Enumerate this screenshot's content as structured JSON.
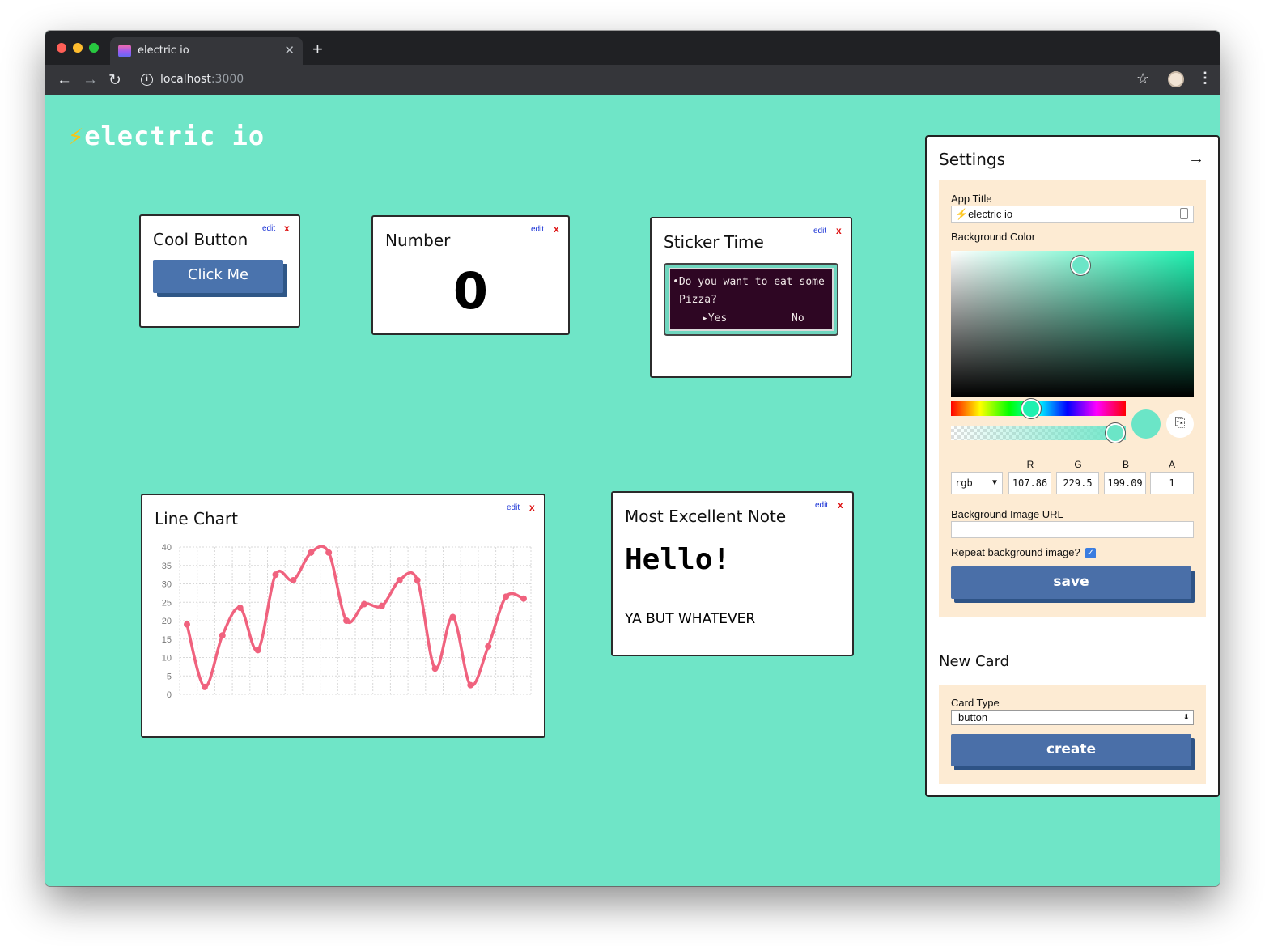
{
  "browser": {
    "tab_title": "electric io",
    "url_host": "localhost",
    "url_port": ":3000",
    "traffic_colors": [
      "#ff5f57",
      "#febc2e",
      "#28c840"
    ]
  },
  "app": {
    "logo_bolt": "⚡",
    "logo_text": "electric io",
    "background_color": "#6fe5c7"
  },
  "cards": {
    "edit_label": "edit",
    "delete_label": "x",
    "cool_button": {
      "title": "Cool Button",
      "button_label": "Click Me"
    },
    "number": {
      "title": "Number",
      "value": "0"
    },
    "sticker": {
      "title": "Sticker Time",
      "line1": "•Do you want to eat some",
      "line2": "Pizza?",
      "yes": "▸Yes",
      "no": "No"
    },
    "line_chart": {
      "title": "Line Chart"
    },
    "note": {
      "title": "Most Excellent Note",
      "heading": "Hello!",
      "body": "YA BUT WHATEVER"
    }
  },
  "chart_data": {
    "type": "line",
    "title": "Line Chart",
    "xlabel": "",
    "ylabel": "",
    "ylim": [
      0,
      40
    ],
    "yticks": [
      "40",
      "35",
      "30",
      "25",
      "20",
      "15",
      "10",
      "5",
      "0"
    ],
    "grid": true,
    "series": [
      {
        "color": "#f0627e",
        "values": [
          19,
          2,
          16,
          23.5,
          12,
          32.5,
          31,
          38.5,
          38.5,
          20,
          24.5,
          24,
          31,
          31,
          7,
          21,
          2.5,
          13,
          26.5,
          26
        ]
      }
    ]
  },
  "settings": {
    "title": "Settings",
    "close_icon": "→",
    "app_title_label": "App Title",
    "app_title_value": "⚡electric io",
    "bg_color_label": "Background Color",
    "picker_hue_color": "#1ff0b0",
    "swatch_color": "#6be5c7",
    "color_mode": "rgb",
    "channel_labels": [
      "R",
      "G",
      "B",
      "A"
    ],
    "channel_values": [
      "107.86",
      "229.5",
      "199.09",
      "1"
    ],
    "bg_image_label": "Background Image URL",
    "bg_image_value": "",
    "repeat_label": "Repeat background image?",
    "repeat_checked": true,
    "save_label": "save"
  },
  "new_card": {
    "title": "New Card",
    "card_type_label": "Card Type",
    "card_type_value": "button",
    "create_label": "create"
  }
}
